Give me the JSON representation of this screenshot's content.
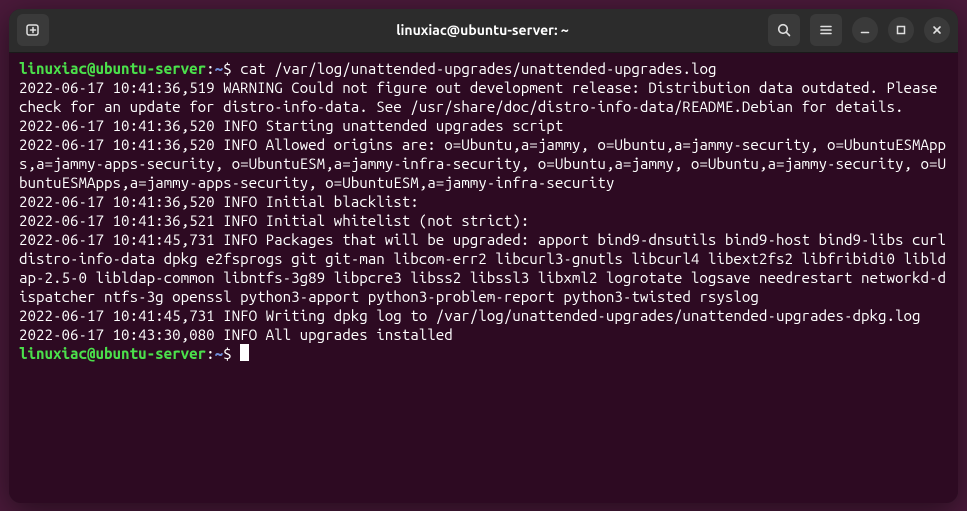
{
  "window": {
    "title": "linuxiac@ubuntu-server: ~"
  },
  "prompt": {
    "userhost": "linuxiac@ubuntu-server",
    "sep": ":",
    "path": "~",
    "dollar": "$"
  },
  "command": "cat /var/log/unattended-upgrades/unattended-upgrades.log",
  "output": "2022-06-17 10:41:36,519 WARNING Could not figure out development release: Distribution data outdated. Please check for an update for distro-info-data. See /usr/share/doc/distro-info-data/README.Debian for details.\n2022-06-17 10:41:36,520 INFO Starting unattended upgrades script\n2022-06-17 10:41:36,520 INFO Allowed origins are: o=Ubuntu,a=jammy, o=Ubuntu,a=jammy-security, o=UbuntuESMApps,a=jammy-apps-security, o=UbuntuESM,a=jammy-infra-security, o=Ubuntu,a=jammy, o=Ubuntu,a=jammy-security, o=UbuntuESMApps,a=jammy-apps-security, o=UbuntuESM,a=jammy-infra-security\n2022-06-17 10:41:36,520 INFO Initial blacklist:\n2022-06-17 10:41:36,521 INFO Initial whitelist (not strict):\n2022-06-17 10:41:45,731 INFO Packages that will be upgraded: apport bind9-dnsutils bind9-host bind9-libs curl distro-info-data dpkg e2fsprogs git git-man libcom-err2 libcurl3-gnutls libcurl4 libext2fs2 libfribidi0 libldap-2.5-0 libldap-common libntfs-3g89 libpcre3 libss2 libssl3 libxml2 logrotate logsave needrestart networkd-dispatcher ntfs-3g openssl python3-apport python3-problem-report python3-twisted rsyslog\n2022-06-17 10:41:45,731 INFO Writing dpkg log to /var/log/unattended-upgrades/unattended-upgrades-dpkg.log\n2022-06-17 10:43:30,080 INFO All upgrades installed"
}
